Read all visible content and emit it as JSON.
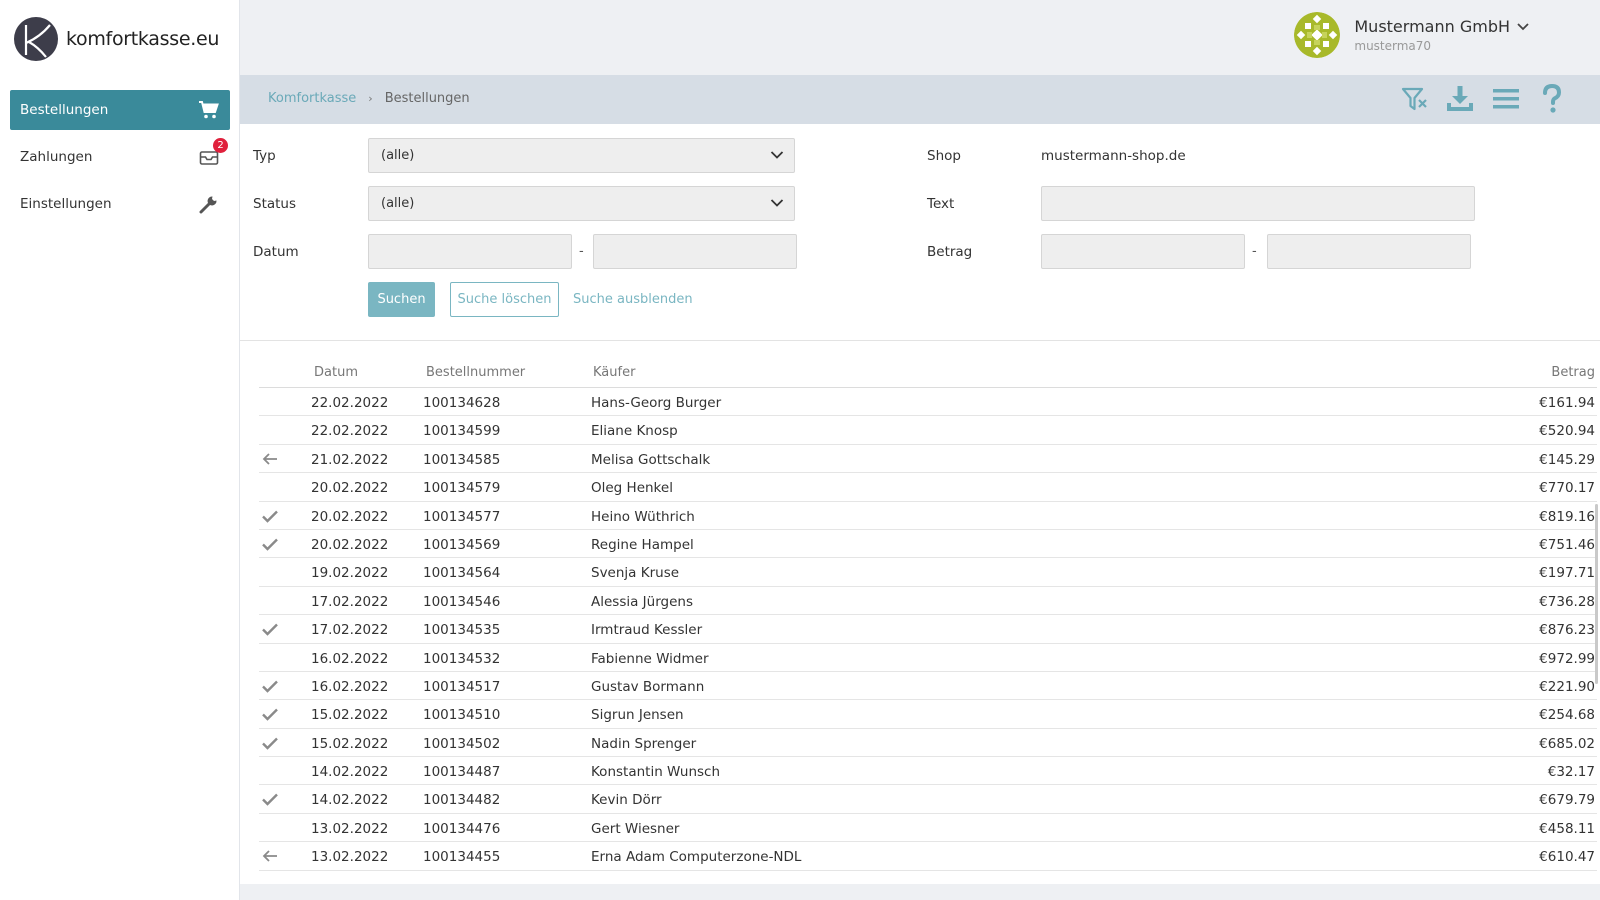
{
  "brand": {
    "name": "komfortkasse.eu"
  },
  "sidebar": {
    "items": [
      {
        "label": "Bestellungen",
        "icon": "cart-icon",
        "active": true
      },
      {
        "label": "Zahlungen",
        "icon": "inbox-icon",
        "badge": "2"
      },
      {
        "label": "Einstellungen",
        "icon": "wrench-icon"
      }
    ]
  },
  "account": {
    "name": "Mustermann GmbH",
    "username": "musterma70"
  },
  "breadcrumb": {
    "root": "Komfortkasse",
    "current": "Bestellungen"
  },
  "toolbar": {
    "icons": [
      "filter-clear-icon",
      "download-icon",
      "menu-icon",
      "help-icon"
    ]
  },
  "search": {
    "type_label": "Typ",
    "type_value": "(alle)",
    "status_label": "Status",
    "status_value": "(alle)",
    "date_label": "Datum",
    "date_from": "",
    "date_to": "",
    "date_sep": "-",
    "shop_label": "Shop",
    "shop_value": "mustermann-shop.de",
    "text_label": "Text",
    "text_value": "",
    "amount_label": "Betrag",
    "amount_from": "",
    "amount_to": "",
    "amount_sep": "-",
    "search_button": "Suchen",
    "clear_button": "Suche löschen",
    "hide_link": "Suche ausblenden"
  },
  "table": {
    "columns": {
      "date": "Datum",
      "order": "Bestellnummer",
      "buyer": "Käufer",
      "amount": "Betrag"
    },
    "rows": [
      {
        "status": "",
        "date": "22.02.2022",
        "order": "100134628",
        "buyer": "Hans-Georg Burger",
        "amount": "€161.94"
      },
      {
        "status": "",
        "date": "22.02.2022",
        "order": "100134599",
        "buyer": "Eliane Knosp",
        "amount": "€520.94"
      },
      {
        "status": "back",
        "date": "21.02.2022",
        "order": "100134585",
        "buyer": "Melisa Gottschalk",
        "amount": "€145.29"
      },
      {
        "status": "",
        "date": "20.02.2022",
        "order": "100134579",
        "buyer": "Oleg Henkel",
        "amount": "€770.17"
      },
      {
        "status": "check",
        "date": "20.02.2022",
        "order": "100134577",
        "buyer": "Heino Wüthrich",
        "amount": "€819.16"
      },
      {
        "status": "check",
        "date": "20.02.2022",
        "order": "100134569",
        "buyer": "Regine Hampel",
        "amount": "€751.46"
      },
      {
        "status": "",
        "date": "19.02.2022",
        "order": "100134564",
        "buyer": "Svenja Kruse",
        "amount": "€197.71"
      },
      {
        "status": "",
        "date": "17.02.2022",
        "order": "100134546",
        "buyer": "Alessia Jürgens",
        "amount": "€736.28"
      },
      {
        "status": "check",
        "date": "17.02.2022",
        "order": "100134535",
        "buyer": "Irmtraud Kessler",
        "amount": "€876.23"
      },
      {
        "status": "",
        "date": "16.02.2022",
        "order": "100134532",
        "buyer": "Fabienne Widmer",
        "amount": "€972.99"
      },
      {
        "status": "check",
        "date": "16.02.2022",
        "order": "100134517",
        "buyer": "Gustav Bormann",
        "amount": "€221.90"
      },
      {
        "status": "check",
        "date": "15.02.2022",
        "order": "100134510",
        "buyer": "Sigrun Jensen",
        "amount": "€254.68"
      },
      {
        "status": "check",
        "date": "15.02.2022",
        "order": "100134502",
        "buyer": "Nadin Sprenger",
        "amount": "€685.02"
      },
      {
        "status": "",
        "date": "14.02.2022",
        "order": "100134487",
        "buyer": "Konstantin Wunsch",
        "amount": "€32.17"
      },
      {
        "status": "check",
        "date": "14.02.2022",
        "order": "100134482",
        "buyer": "Kevin Dörr",
        "amount": "€679.79"
      },
      {
        "status": "",
        "date": "13.02.2022",
        "order": "100134476",
        "buyer": "Gert Wiesner",
        "amount": "€458.11"
      },
      {
        "status": "back",
        "date": "13.02.2022",
        "order": "100134455",
        "buyer": "Erna Adam Computerzone-NDL",
        "amount": "€610.47"
      }
    ]
  },
  "colors": {
    "accent": "#3a8a9a",
    "link": "#7ab6c2",
    "badge": "#e0203c",
    "avatar": "#a8b92a"
  }
}
